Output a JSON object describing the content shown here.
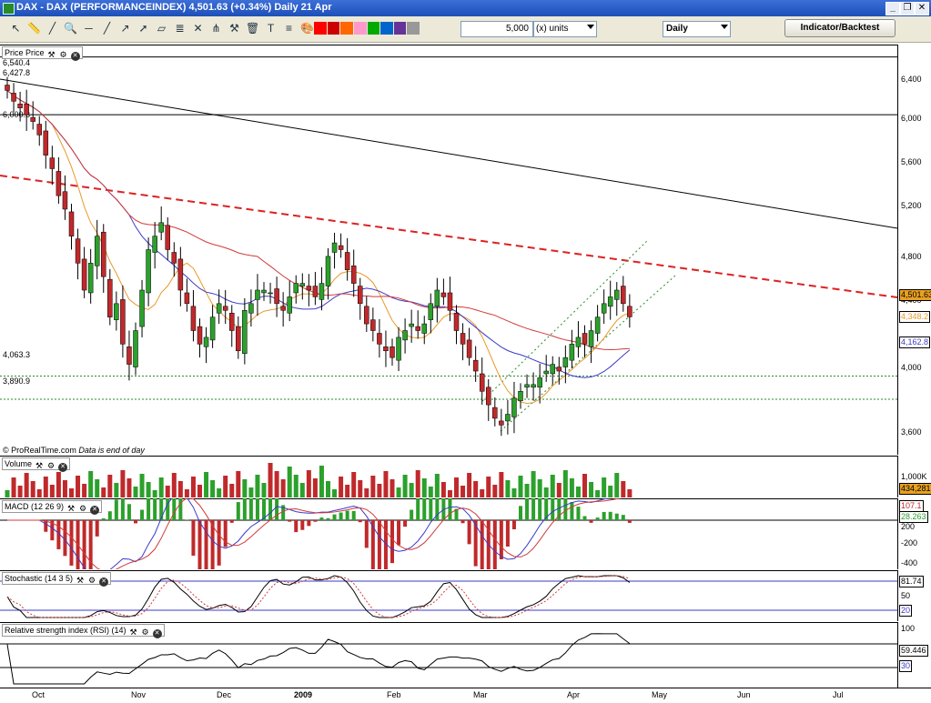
{
  "window": {
    "title": "DAX - DAX (PERFORMANCEINDEX)    4,501.63 (+0.34%)    Daily  21 Apr"
  },
  "toolbar": {
    "quantity": "5,000",
    "units": "(x) units",
    "period": "Daily",
    "indicator_button": "Indicator/Backtest"
  },
  "price_panel": {
    "label": "Price Price",
    "levels": [
      "6,540.4",
      "6,427.8",
      "6,000.3",
      "4,063.3",
      "3,890.9"
    ],
    "footer": "© ProRealTime.com",
    "footer_note": "Data is end of day",
    "axis_ticks": [
      "6,400",
      "6,000",
      "5,600",
      "5,200",
      "4,800",
      "4,400",
      "4,000",
      "3,600"
    ],
    "tags": [
      "4,501.63",
      "4,348.2",
      "4,162.8"
    ],
    "colors": {
      "up": "#2ca02c",
      "down": "#c0292b",
      "ma_red": "#d23a3a",
      "ma_blue": "#3b3bc8",
      "ma_orange": "#e89a2a"
    }
  },
  "volume_panel": {
    "label": "Volume",
    "axis_tick": "1,000K",
    "tag": "434,281"
  },
  "macd_panel": {
    "label": "MACD (12 26 9)",
    "axis_ticks": [
      "200",
      "-200",
      "-400"
    ],
    "tags": [
      "107.1",
      "28.263"
    ]
  },
  "stoch_panel": {
    "label": "Stochastic (14 3 5)",
    "axis_ticks": [
      "50",
      "20"
    ],
    "tags": [
      "81.74"
    ]
  },
  "rsi_panel": {
    "label": "Relative strength index (RSI) (14)",
    "axis_ticks": [
      "100",
      "59.446",
      "30"
    ]
  },
  "x_axis": [
    "Oct",
    "Nov",
    "Dec",
    "2009",
    "Feb",
    "Mar",
    "Apr",
    "May",
    "Jun",
    "Jul"
  ],
  "chart_data": {
    "type": "candlestick",
    "title": "DAX - DAX (PERFORMANCEINDEX)",
    "last": 4501.63,
    "change_pct": 0.34,
    "date": "21 Apr",
    "y_range": [
      3480,
      6520
    ],
    "x_labels": [
      "Oct",
      "Nov",
      "Dec",
      "2009",
      "Feb",
      "Mar",
      "Apr",
      "May",
      "Jun",
      "Jul"
    ],
    "horizontal_levels": [
      6540.4,
      6427.8,
      6000.3,
      4063.3,
      3890.9
    ],
    "close_series": [
      6180,
      6100,
      6050,
      6000,
      5950,
      5850,
      5700,
      5600,
      5400,
      5300,
      5100,
      4900,
      4700,
      4900,
      5100,
      4800,
      4500,
      4600,
      4300,
      4150,
      4400,
      4700,
      5000,
      5100,
      5200,
      5000,
      4900,
      4700,
      4600,
      4400,
      4300,
      4350,
      4500,
      4600,
      4550,
      4400,
      4250,
      4550,
      4600,
      4700,
      4700,
      4680,
      4600,
      4550,
      4650,
      4750,
      4750,
      4700,
      4650,
      4750,
      4950,
      5050,
      5000,
      4850,
      4750,
      4600,
      4450,
      4400,
      4300,
      4250,
      4200,
      4350,
      4400,
      4450,
      4400,
      4450,
      4600,
      4700,
      4650,
      4550,
      4400,
      4300,
      4200,
      4100,
      3950,
      3850,
      3750,
      3700,
      3780,
      3900,
      3950,
      4000,
      4000,
      4050,
      4100,
      4150,
      4100,
      4200,
      4300,
      4350,
      4300,
      4400,
      4500,
      4600,
      4650,
      4700,
      4600,
      4501.63
    ]
  }
}
